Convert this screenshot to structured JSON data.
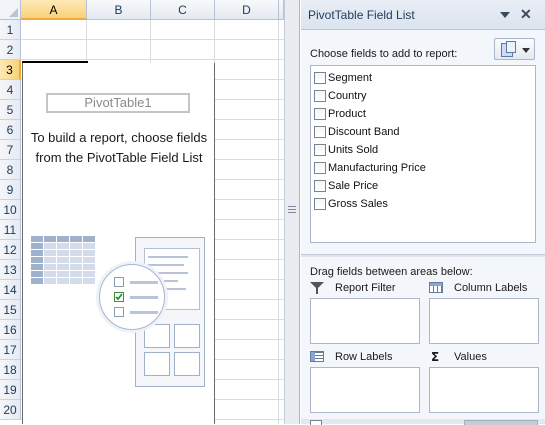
{
  "sheet": {
    "columns": [
      "A",
      "B",
      "C",
      "D"
    ],
    "rows": [
      "1",
      "2",
      "3",
      "4",
      "5",
      "6",
      "7",
      "8",
      "9",
      "10",
      "11",
      "12",
      "13",
      "14",
      "15",
      "16",
      "17",
      "18",
      "19",
      "20"
    ],
    "selected_column": "A",
    "selected_row": "3"
  },
  "pivot": {
    "name": "PivotTable1",
    "message": "To build a report, choose fields from the PivotTable Field List"
  },
  "pane": {
    "title": "PivotTable Field List",
    "choose_label": "Choose fields to add to report:",
    "fields": [
      {
        "label": "Segment",
        "checked": false
      },
      {
        "label": "Country",
        "checked": false
      },
      {
        "label": "Product",
        "checked": false
      },
      {
        "label": "Discount Band",
        "checked": false
      },
      {
        "label": "Units Sold",
        "checked": false
      },
      {
        "label": "Manufacturing Price",
        "checked": false
      },
      {
        "label": "Sale Price",
        "checked": false
      },
      {
        "label": "Gross Sales",
        "checked": false
      }
    ],
    "drag_label": "Drag fields between areas below:",
    "areas": {
      "report_filter": "Report Filter",
      "column_labels": "Column Labels",
      "row_labels": "Row Labels",
      "values": "Values"
    },
    "icons": {
      "dropdown": "dropdown-arrow-icon",
      "close": "close-icon",
      "layout": "field-list-layout-icon",
      "filter": "filter-funnel-icon",
      "columns": "column-labels-icon",
      "rows": "row-labels-icon",
      "values": "sigma-icon"
    }
  },
  "colors": {
    "header_bg": "#e4e9f0",
    "selected_header": "#f8d27a",
    "pane_bg": "#f3f6fa",
    "accent_text": "#1e395b"
  }
}
